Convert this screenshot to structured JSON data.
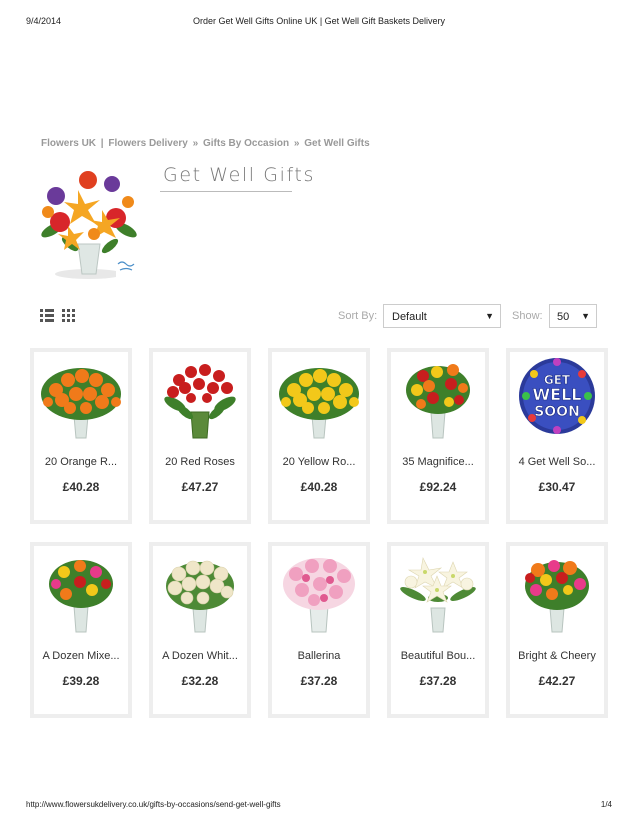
{
  "print_header": {
    "date": "9/4/2014",
    "title": "Order Get Well Gifts Online UK | Get Well Gift Baskets Delivery"
  },
  "breadcrumb": {
    "items": [
      "Flowers UK",
      "Flowers Delivery",
      "Gifts By Occasion",
      "Get Well Gifts"
    ],
    "sep_pipe": "|",
    "sep_arrow": "»"
  },
  "page_title": "Get Well Gifts",
  "toolbar": {
    "sort_label": "Sort By:",
    "sort_value": "Default",
    "show_label": "Show:",
    "show_value": "50",
    "caret": "▼"
  },
  "products": [
    {
      "name": "20 Orange R...",
      "price": "£40.28"
    },
    {
      "name": "20 Red Roses",
      "price": "£47.27"
    },
    {
      "name": "20 Yellow Ro...",
      "price": "£40.28"
    },
    {
      "name": "35 Magnifice...",
      "price": "£92.24"
    },
    {
      "name": "4 Get Well So...",
      "price": "£30.47"
    },
    {
      "name": "A Dozen Mixe...",
      "price": "£39.28"
    },
    {
      "name": "A Dozen Whit...",
      "price": "£32.28"
    },
    {
      "name": "Ballerina",
      "price": "£37.28"
    },
    {
      "name": "Beautiful Bou...",
      "price": "£37.28"
    },
    {
      "name": "Bright & Cheery",
      "price": "£42.27"
    }
  ],
  "print_footer": {
    "url": "http://www.flowersukdelivery.co.uk/gifts-by-occasions/send-get-well-gifts",
    "pages": "1/4"
  },
  "balloon_text": [
    "GET",
    "WELL",
    "SOON"
  ],
  "colors": {
    "orange_rose": "#f07a1a",
    "red_rose": "#c81e1e",
    "yellow_rose": "#f2c81a",
    "pink": "#f0a0c0",
    "cream": "#efe6c8",
    "leaf": "#3e7f2a"
  }
}
